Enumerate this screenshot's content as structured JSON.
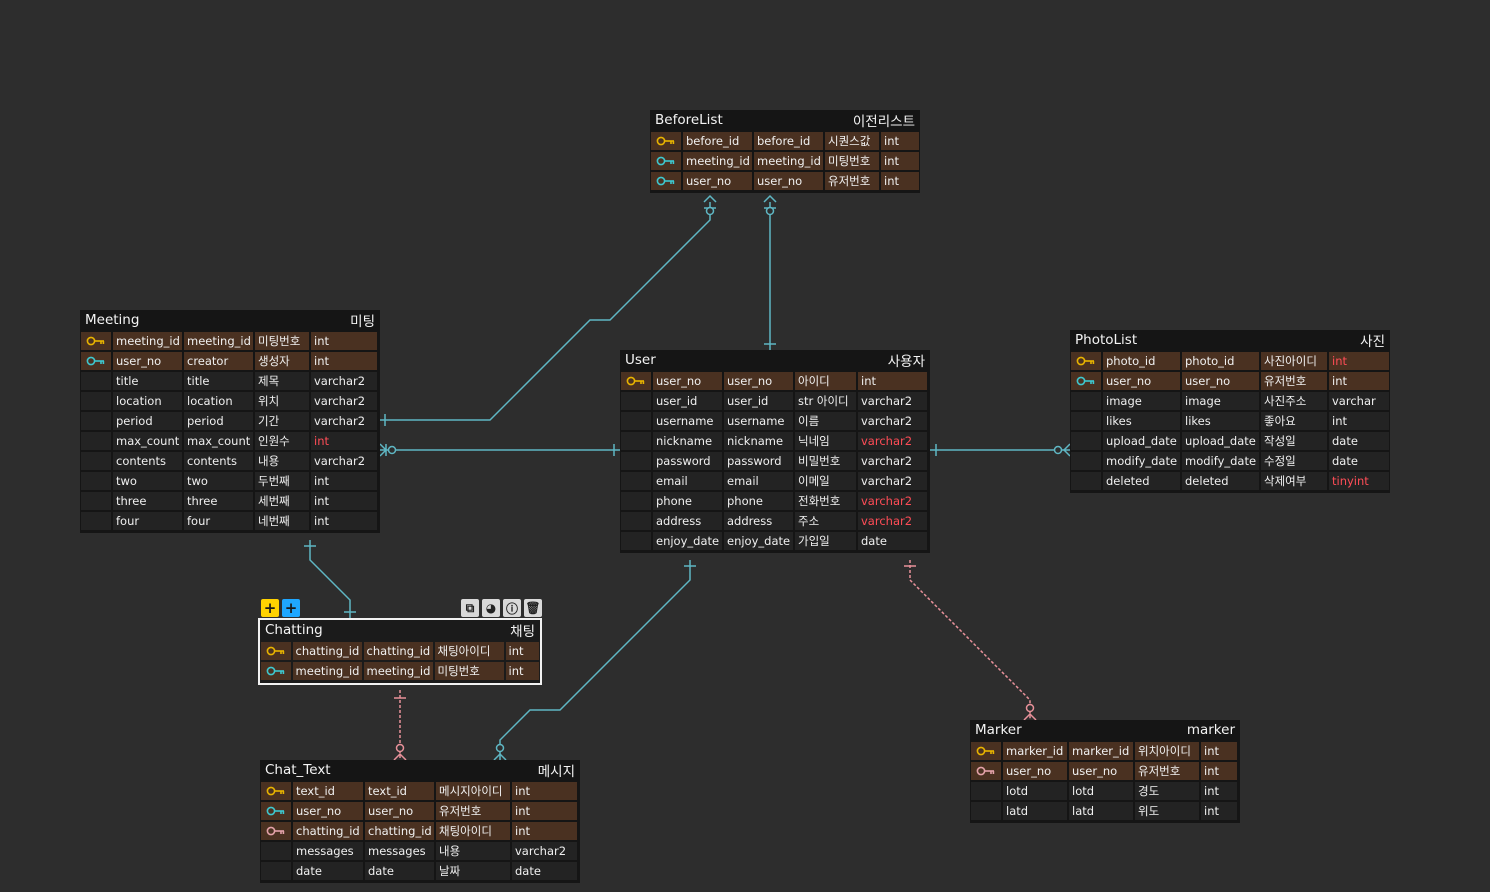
{
  "colors": {
    "background": "#2d2d2d",
    "relation_line": "#5fb7c4",
    "relation_dashed": "#e8919a",
    "row_key": "#4a3121",
    "row_normal": "#232323",
    "pk_icon": "#e8b400",
    "fk_icon": "#3ec8cf",
    "nfk_icon": "#e3a2a9",
    "type_error": "#ff4d57"
  },
  "toolbar": {
    "add_yellow": "+",
    "add_blue": "+",
    "icons": [
      "copy-icon",
      "palette-icon",
      "info-icon",
      "trash-icon"
    ]
  },
  "tables": {
    "beforelist": {
      "name": "BeforeList",
      "comment": "이전리스트",
      "columns": [
        {
          "key": "pk",
          "name": "before_id",
          "logical": "before_id",
          "comment": "시퀀스값",
          "type": "int"
        },
        {
          "key": "fk",
          "name": "meeting_id",
          "logical": "meeting_id",
          "comment": "미팅번호",
          "type": "int"
        },
        {
          "key": "fk",
          "name": "user_no",
          "logical": "user_no",
          "comment": "유저번호",
          "type": "int"
        }
      ]
    },
    "meeting": {
      "name": "Meeting",
      "comment": "미팅",
      "columns": [
        {
          "key": "pk",
          "name": "meeting_id",
          "logical": "meeting_id",
          "comment": "미팅번호",
          "type": "int"
        },
        {
          "key": "fk",
          "name": "user_no",
          "logical": "creator",
          "comment": "생성자",
          "type": "int"
        },
        {
          "key": "",
          "name": "title",
          "logical": "title",
          "comment": "제목",
          "type": "varchar2"
        },
        {
          "key": "",
          "name": "location",
          "logical": "location",
          "comment": "위치",
          "type": "varchar2"
        },
        {
          "key": "",
          "name": "period",
          "logical": "period",
          "comment": "기간",
          "type": "varchar2"
        },
        {
          "key": "",
          "name": "max_count",
          "logical": "max_count",
          "comment": "인원수",
          "type": "int",
          "error": true
        },
        {
          "key": "",
          "name": "contents",
          "logical": "contents",
          "comment": "내용",
          "type": "varchar2"
        },
        {
          "key": "",
          "name": "two",
          "logical": "two",
          "comment": "두번째",
          "type": "int"
        },
        {
          "key": "",
          "name": "three",
          "logical": "three",
          "comment": "세번째",
          "type": "int"
        },
        {
          "key": "",
          "name": "four",
          "logical": "four",
          "comment": "네번째",
          "type": "int"
        }
      ]
    },
    "user": {
      "name": "User",
      "comment": "사용자",
      "columns": [
        {
          "key": "pk",
          "name": "user_no",
          "logical": "user_no",
          "comment": "아이디",
          "type": "int"
        },
        {
          "key": "",
          "name": "user_id",
          "logical": "user_id",
          "comment": "str 아이디",
          "type": "varchar2"
        },
        {
          "key": "",
          "name": "username",
          "logical": "username",
          "comment": "이름",
          "type": "varchar2"
        },
        {
          "key": "",
          "name": "nickname",
          "logical": "nickname",
          "comment": "닉네임",
          "type": "varchar2",
          "error": true
        },
        {
          "key": "",
          "name": "password",
          "logical": "password",
          "comment": "비밀번호",
          "type": "varchar2"
        },
        {
          "key": "",
          "name": "email",
          "logical": "email",
          "comment": "이메일",
          "type": "varchar2"
        },
        {
          "key": "",
          "name": "phone",
          "logical": "phone",
          "comment": "전화번호",
          "type": "varchar2",
          "error": true
        },
        {
          "key": "",
          "name": "address",
          "logical": "address",
          "comment": "주소",
          "type": "varchar2",
          "error": true
        },
        {
          "key": "",
          "name": "enjoy_date",
          "logical": "enjoy_date",
          "comment": "가입일",
          "type": "date"
        }
      ]
    },
    "photolist": {
      "name": "PhotoList",
      "comment": "사진",
      "columns": [
        {
          "key": "pk",
          "name": "photo_id",
          "logical": "photo_id",
          "comment": "사진아이디",
          "type": "int",
          "error": true
        },
        {
          "key": "fk",
          "name": "user_no",
          "logical": "user_no",
          "comment": "유저번호",
          "type": "int"
        },
        {
          "key": "",
          "name": "image",
          "logical": "image",
          "comment": "사진주소",
          "type": "varchar"
        },
        {
          "key": "",
          "name": "likes",
          "logical": "likes",
          "comment": "좋아요",
          "type": "int"
        },
        {
          "key": "",
          "name": "upload_date",
          "logical": "upload_date",
          "comment": "작성일",
          "type": "date"
        },
        {
          "key": "",
          "name": "modify_date",
          "logical": "modify_date",
          "comment": "수정일",
          "type": "date"
        },
        {
          "key": "",
          "name": "deleted",
          "logical": "deleted",
          "comment": "삭제여부",
          "type": "tinyint",
          "error": true
        }
      ]
    },
    "chatting": {
      "name": "Chatting",
      "comment": "채팅",
      "columns": [
        {
          "key": "pk",
          "name": "chatting_id",
          "logical": "chatting_id",
          "comment": "채팅아이디",
          "type": "int"
        },
        {
          "key": "fk",
          "name": "meeting_id",
          "logical": "meeting_id",
          "comment": "미팅번호",
          "type": "int"
        }
      ]
    },
    "chat_text": {
      "name": "Chat_Text",
      "comment": "메시지",
      "columns": [
        {
          "key": "pk",
          "name": "text_id",
          "logical": "text_id",
          "comment": "메시지아이디",
          "type": "int"
        },
        {
          "key": "fk",
          "name": "user_no",
          "logical": "user_no",
          "comment": "유저번호",
          "type": "int"
        },
        {
          "key": "nfk",
          "name": "chatting_id",
          "logical": "chatting_id",
          "comment": "채팅아이디",
          "type": "int"
        },
        {
          "key": "",
          "name": "messages",
          "logical": "messages",
          "comment": "내용",
          "type": "varchar2"
        },
        {
          "key": "",
          "name": "date",
          "logical": "date",
          "comment": "날짜",
          "type": "date"
        }
      ]
    },
    "marker": {
      "name": "Marker",
      "comment": "marker",
      "columns": [
        {
          "key": "pk",
          "name": "marker_id",
          "logical": "marker_id",
          "comment": "위치아이디",
          "type": "int"
        },
        {
          "key": "nfk",
          "name": "user_no",
          "logical": "user_no",
          "comment": "유저번호",
          "type": "int"
        },
        {
          "key": "",
          "name": "lotd",
          "logical": "lotd",
          "comment": "경도",
          "type": "int"
        },
        {
          "key": "",
          "name": "latd",
          "logical": "latd",
          "comment": "위도",
          "type": "int"
        }
      ]
    }
  }
}
